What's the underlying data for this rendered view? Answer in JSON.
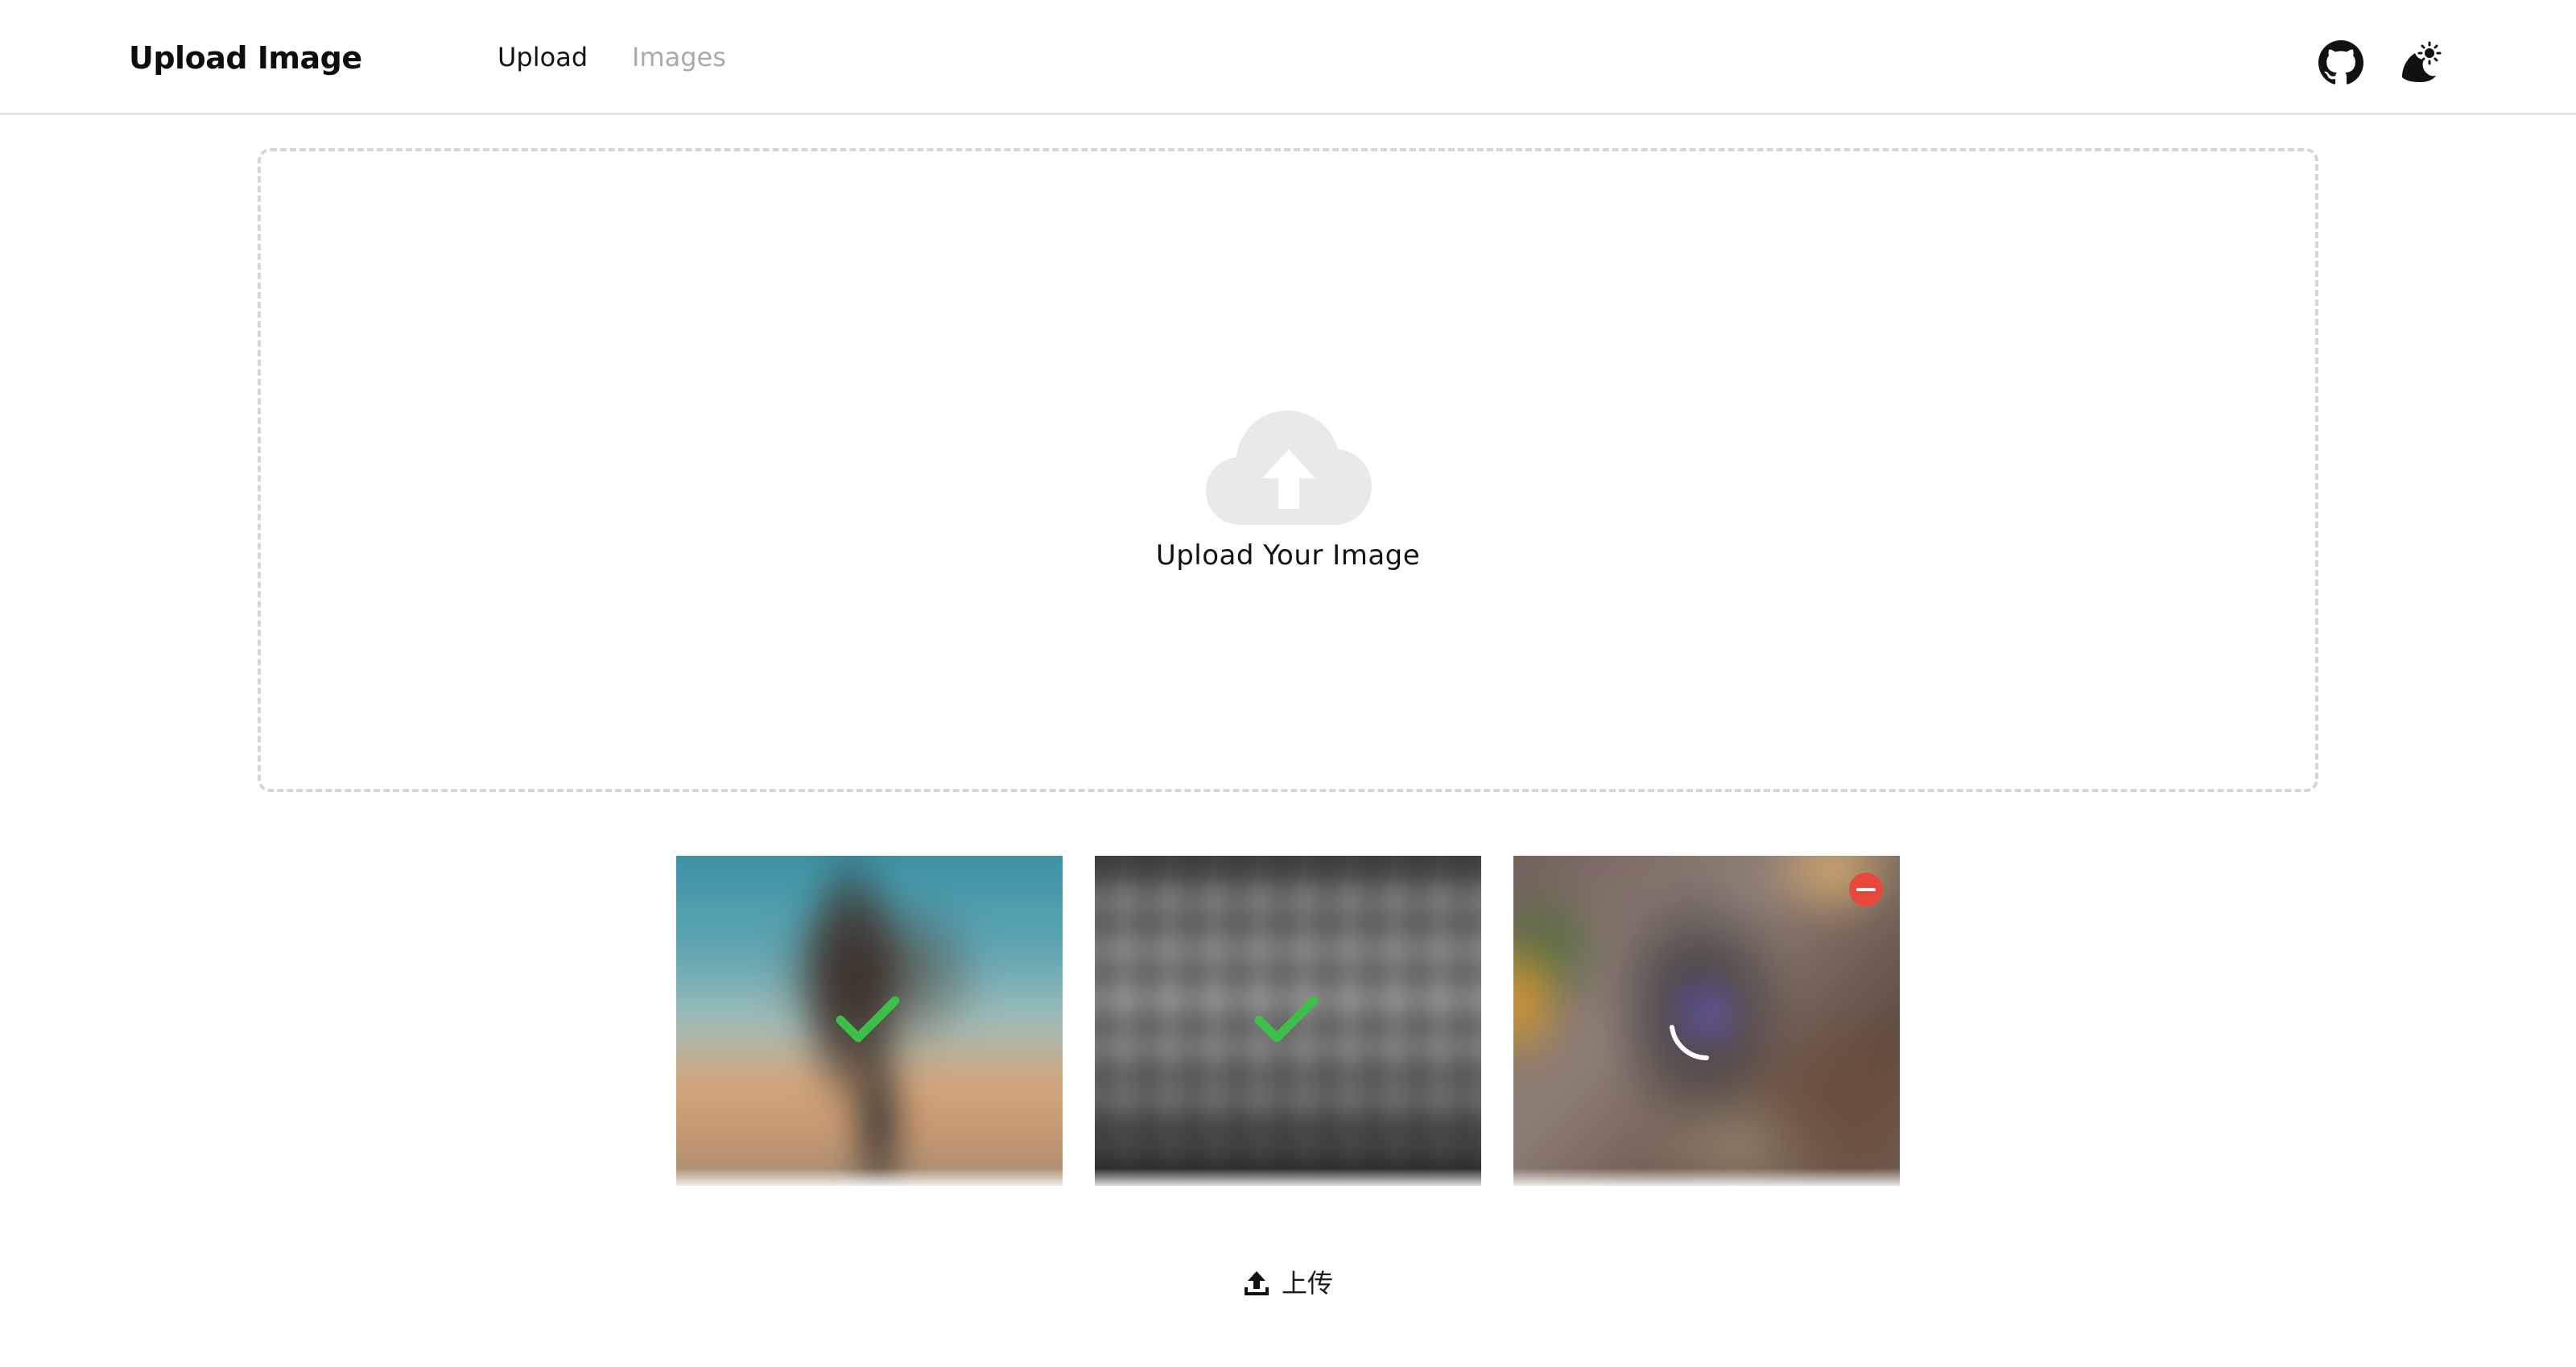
{
  "header": {
    "brand": "Upload Image",
    "nav": [
      {
        "label": "Upload",
        "active": true
      },
      {
        "label": "Images",
        "active": false
      }
    ],
    "icons": [
      "github-icon",
      "theme-toggle-icon"
    ]
  },
  "dropzone": {
    "icon": "cloud-upload-icon",
    "label": "Upload Your Image"
  },
  "files": [
    {
      "status": "uploaded",
      "status_icon": "check-icon"
    },
    {
      "status": "uploaded",
      "status_icon": "check-icon"
    },
    {
      "status": "uploading",
      "status_icon": "spinner-icon",
      "removable": true
    }
  ],
  "actions": {
    "upload_label": "上传",
    "upload_icon": "upload-icon"
  },
  "colors": {
    "success": "#3dbf4a",
    "danger": "#e8483c",
    "dropzone_border": "#d6d6d6",
    "inactive_nav": "#aaaaaa"
  }
}
